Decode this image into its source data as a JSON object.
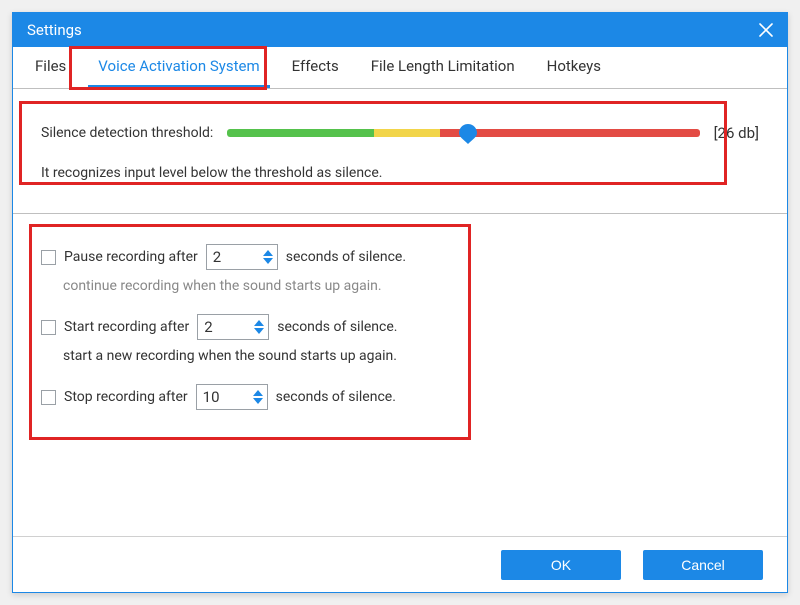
{
  "title": "Settings",
  "tabs": {
    "files": "Files",
    "vas": "Voice Activation System",
    "effects": "Effects",
    "fll": "File Length Limitation",
    "hotkeys": "Hotkeys"
  },
  "silence": {
    "label": "Silence detection threshold:",
    "value_display": "[26 db]",
    "help": "It recognizes input level below the threshold as silence."
  },
  "opts": {
    "pause": {
      "label_before": "Pause recording after",
      "value": "2",
      "label_after": "seconds of silence.",
      "help": "continue recording when the sound starts up again."
    },
    "start": {
      "label_before": "Start recording after",
      "value": "2",
      "label_after": "seconds of silence.",
      "help": "start a new recording when the sound starts up again."
    },
    "stop": {
      "label_before": "Stop recording after",
      "value": "10",
      "label_after": "seconds of silence."
    }
  },
  "buttons": {
    "ok": "OK",
    "cancel": "Cancel"
  }
}
